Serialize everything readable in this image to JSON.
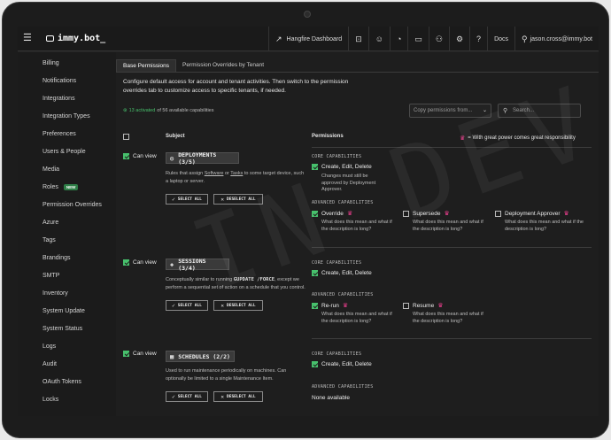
{
  "app": {
    "logo": "immy.bot_"
  },
  "topnav": {
    "hangfire": "Hangfire Dashboard",
    "docs": "Docs",
    "user": "jason.cross@immy.bot"
  },
  "sidebar": {
    "items": [
      {
        "label": "Billing"
      },
      {
        "label": "Notifications"
      },
      {
        "label": "Integrations"
      },
      {
        "label": "Integration Types"
      },
      {
        "label": "Preferences"
      },
      {
        "label": "Users & People"
      },
      {
        "label": "Media"
      },
      {
        "label": "Roles",
        "badge": "NEW"
      },
      {
        "label": "Permission Overrides"
      },
      {
        "label": "Azure"
      },
      {
        "label": "Tags"
      },
      {
        "label": "Brandings"
      },
      {
        "label": "SMTP"
      },
      {
        "label": "Inventory"
      },
      {
        "label": "System Update"
      },
      {
        "label": "System Status"
      },
      {
        "label": "Logs"
      },
      {
        "label": "Audit"
      },
      {
        "label": "OAuth Tokens"
      },
      {
        "label": "Locks"
      }
    ]
  },
  "tabs": [
    "Base Permissions",
    "Permission Overrides by Tenant"
  ],
  "intro": "Configure default access for account and tenant activities. Then switch to the permission overrides tab to customize access to specific tenants, if needed.",
  "activated": {
    "count": "13 activated",
    "rest": "of 56 available capabilities"
  },
  "copy_placeholder": "Copy permissions from...",
  "search_placeholder": "Search...",
  "headers": {
    "subject": "Subject",
    "permissions": "Permissions",
    "legend": "= With great power comes great responsibility"
  },
  "watermark": "IN DEV",
  "labels": {
    "can_view": "Can view",
    "select_all": "SELECT ALL",
    "deselect_all": "DESELECT ALL",
    "core": "CORE CAPABILITIES",
    "advanced": "ADVANCED CAPABILITIES",
    "what": "What does this mean and what if the description is long?"
  },
  "groups": [
    {
      "title": "DEPLOYMENTS (3/5)",
      "desc_a": "Rules that assign ",
      "desc_software": "Software",
      "desc_or": " or ",
      "desc_tasks": "Tasks",
      "desc_b": " to some target device, such a laptop or server.",
      "core": "Create, Edit, Delete",
      "core_note": "Changes must still be approved by Deployment Approver.",
      "adv": [
        "Override",
        "Supersede",
        "Deployment Approver"
      ]
    },
    {
      "title": "SESSIONS (3/4)",
      "desc_a": "Conceptually similar to running ",
      "desc_mono": "GUPDATE /FORCE",
      "desc_b": ", except we perform a sequential set of action on a schedule that you control.",
      "core": "Create, Edit, Delete",
      "adv": [
        "Re-run",
        "Resume"
      ]
    },
    {
      "title": "SCHEDULES (2/2)",
      "desc": "Used to run maintenance periodically on machines. Can optionally be limited to a single Maintenance Item.",
      "core": "Create, Edit, Delete",
      "none": "None available"
    }
  ],
  "colors": {
    "accent_green": "#47c06c",
    "crown_pink": "#e83e8c",
    "background": "#1e1e1e"
  }
}
